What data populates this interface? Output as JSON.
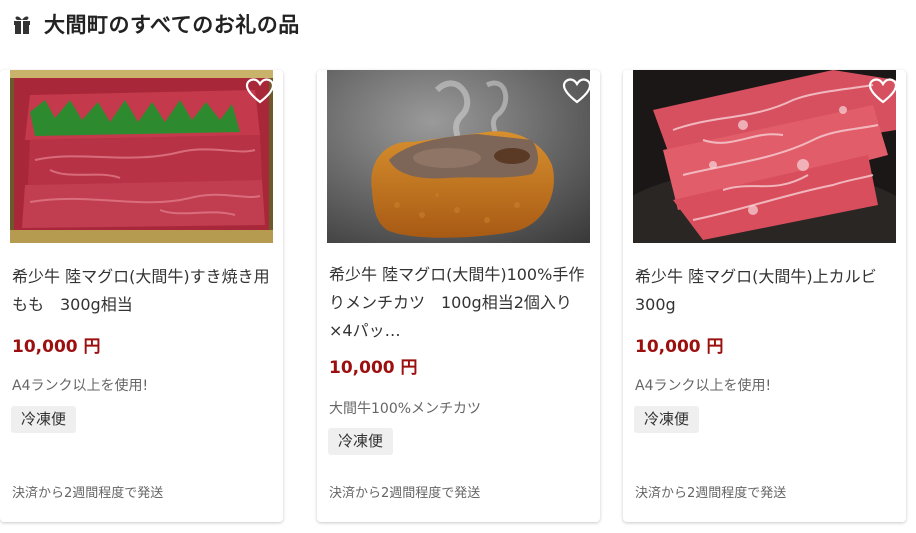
{
  "header": {
    "icon": "gift-icon",
    "title": "大間町のすべてのお礼の品"
  },
  "colors": {
    "price": "#9c0f0f",
    "badge_bg": "#efefef"
  },
  "items": [
    {
      "image": "menchi-katsu-photo",
      "title": "希少牛 陸マグロ(大間牛)100%手作りメンチカツ　100g相当2個入り×4パッ…",
      "price": "10,000 円",
      "catch": "大間牛100%メンチカツ",
      "badge": "冷凍便",
      "shipping": "決済から2週間程度で発送",
      "fav_icon": "heart-outline-icon"
    },
    {
      "image": "karubi-beef-photo",
      "title": "希少牛 陸マグロ(大間牛)上カルビ　300g",
      "price": "10,000 円",
      "catch": "A4ランク以上を使用!",
      "badge": "冷凍便",
      "shipping": "決済から2週間程度で発送",
      "fav_icon": "heart-outline-icon"
    },
    {
      "image": "sukiyaki-beef-photo",
      "title": "希少牛 陸マグロ(大間牛)すき焼き用もも　300g相当",
      "price": "10,000 円",
      "catch": "A4ランク以上を使用!",
      "badge": "冷凍便",
      "shipping": "決済から2週間程度で発送",
      "fav_icon": "heart-outline-icon"
    }
  ]
}
